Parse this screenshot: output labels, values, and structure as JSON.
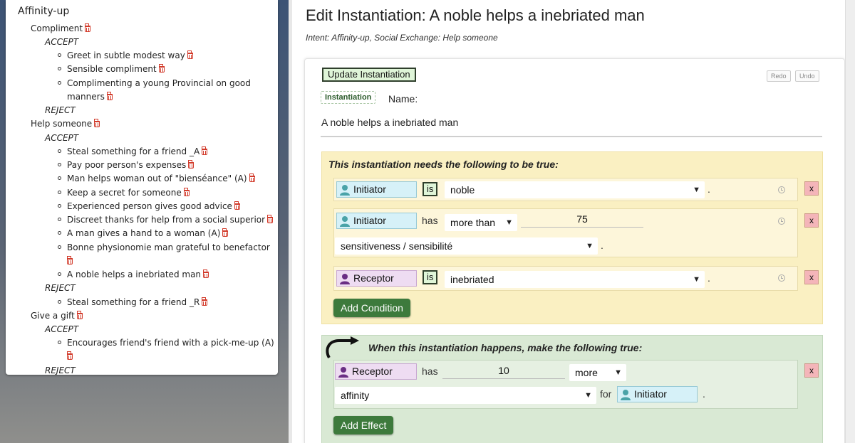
{
  "tree": {
    "root": "Affinity-up",
    "groups": [
      {
        "label": "Compliment",
        "accept": "ACCEPT",
        "accept_items": [
          "Greet in subtle modest way",
          "Sensible compliment",
          "Complimenting a young Provincial on good",
          "manners"
        ],
        "reject": "REJECT"
      },
      {
        "label": "Help someone",
        "accept": "ACCEPT",
        "accept_items": [
          "Steal something for a friend _A",
          "Pay poor person's expenses",
          "Man helps woman out of \"bienséance\" (A)",
          "Keep a secret for someone",
          "Experienced person gives good advice",
          "Discreet thanks for help from a social superior",
          "A man gives a hand to a woman (A)",
          "Bonne physionomie man grateful to benefactor",
          "A noble helps a inebriated man"
        ],
        "reject": "REJECT",
        "reject_items": [
          "Steal something for a friend _R"
        ]
      },
      {
        "label": "Give a gift",
        "accept": "ACCEPT",
        "accept_items": [
          "Encourages friend's friend with a pick-me-up (A)"
        ],
        "reject": "REJECT"
      }
    ]
  },
  "page": {
    "title": "Edit Instantiation: A noble helps a inebriated man",
    "intent": "Intent: Affinity-up, Social Exchange: Help someone"
  },
  "toolbar": {
    "update_label": "Update Instantiation",
    "redo_label": "Redo",
    "undo_label": "Undo"
  },
  "instantiation": {
    "tag": "Instantiation",
    "name_label": "Name:",
    "name_value": "A noble helps a inebriated man"
  },
  "conditions": {
    "title": "This instantiation needs the following to be true:",
    "rows": [
      {
        "who": "Initiator",
        "op": "is",
        "value": "noble",
        "dot": "."
      },
      {
        "who": "Initiator",
        "op": "has",
        "comparator": "more than",
        "amount": "75",
        "trait": "sensitiveness / sensibilité",
        "dot": "."
      },
      {
        "who": "Receptor",
        "op": "is",
        "value": "inebriated",
        "dot": "."
      }
    ],
    "add_label": "Add Condition",
    "remove_label": "x"
  },
  "effects": {
    "title": "When this instantiation happens, make the following true:",
    "row": {
      "who": "Receptor",
      "op": "has",
      "amount": "10",
      "direction": "more",
      "trait": "affinity",
      "for_label": "for",
      "target": "Initiator",
      "dot": "."
    },
    "add_label": "Add Effect",
    "remove_label": "x"
  },
  "colors": {
    "initiator_chip": "#d6f1f8",
    "receptor_chip": "#eedcf2",
    "initiator_icon": "#4aa3a8",
    "receptor_icon": "#6a2e84",
    "button_green": "#3d7a3c",
    "condition_bg": "#faf0c2",
    "effect_bg": "#d9e9d4",
    "remove_red": "#f4b5b9",
    "trash_red": "#d23a2a"
  }
}
